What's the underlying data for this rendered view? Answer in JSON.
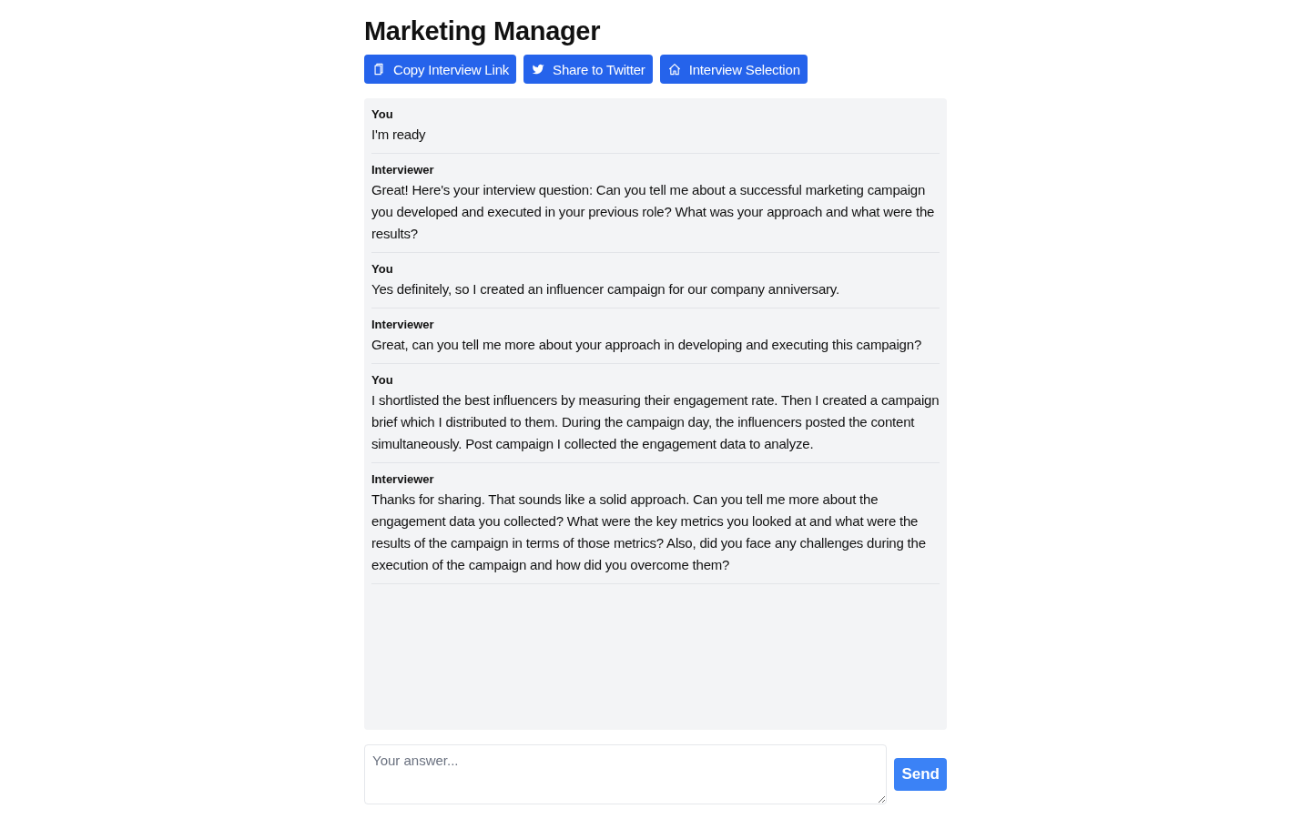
{
  "title": "Marketing Manager",
  "actions": [
    {
      "kind": "copy",
      "label": "Copy Interview Link"
    },
    {
      "kind": "twitter",
      "label": "Share to Twitter"
    },
    {
      "kind": "home",
      "label": "Interview Selection"
    }
  ],
  "messages": [
    {
      "sender": "You",
      "text": "I'm ready"
    },
    {
      "sender": "Interviewer",
      "text": "Great! Here's your interview question: Can you tell me about a successful marketing campaign you developed and executed in your previous role? What was your approach and what were the results?"
    },
    {
      "sender": "You",
      "text": "Yes definitely, so I created an influencer campaign for our company anniversary."
    },
    {
      "sender": "Interviewer",
      "text": "Great, can you tell me more about your approach in developing and executing this campaign?"
    },
    {
      "sender": "You",
      "text": "I shortlisted the best influencers by measuring their engagement rate. Then I created a campaign brief which I distributed to them. During the campaign day, the influencers posted the content simultaneously. Post campaign I collected the engagement data to analyze."
    },
    {
      "sender": "Interviewer",
      "text": "Thanks for sharing. That sounds like a solid approach. Can you tell me more about the engagement data you collected? What were the key metrics you looked at and what were the results of the campaign in terms of those metrics? Also, did you face any challenges during the execution of the campaign and how did you overcome them?"
    }
  ],
  "answer": {
    "placeholder": "Your answer..."
  },
  "send_button": "Send"
}
